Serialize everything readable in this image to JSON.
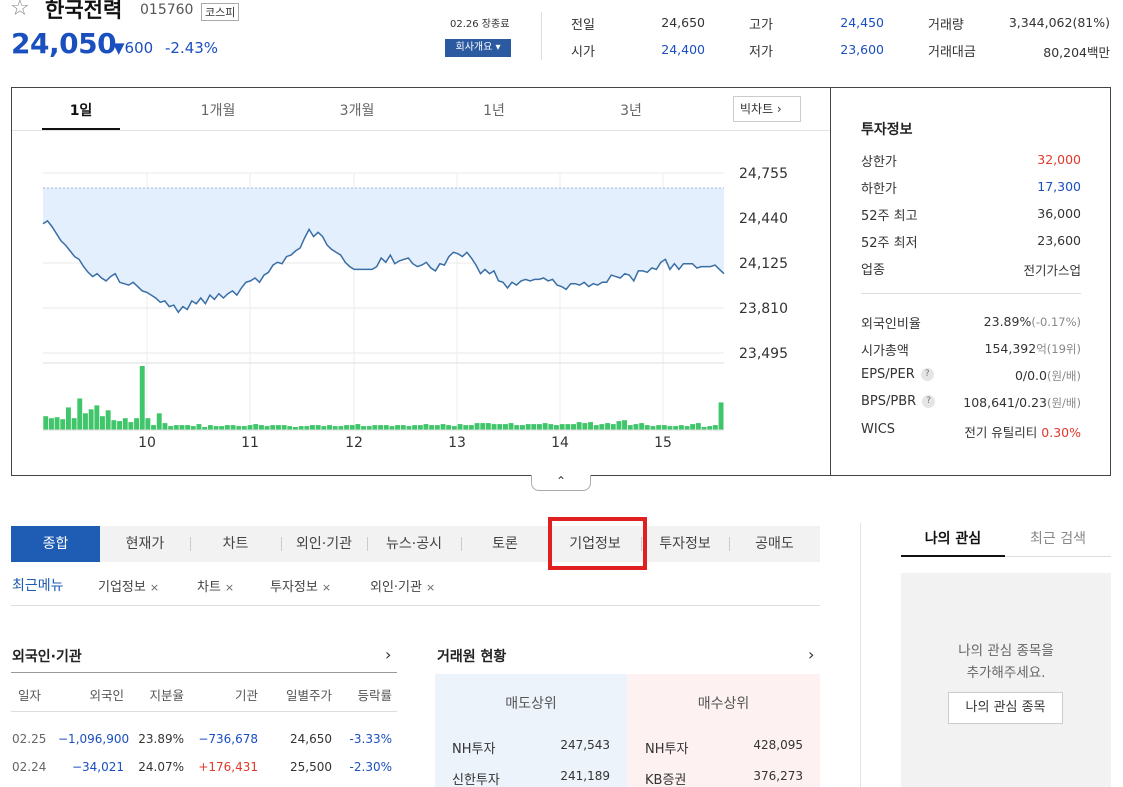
{
  "stock": {
    "name": "한국전력",
    "code": "015760",
    "market": "코스피",
    "price": "24,050",
    "change_arrow": "▼",
    "change": "600",
    "change_pct": "-2.43%",
    "status": "02.26 장종료",
    "company_btn": "회사개요 ▾"
  },
  "summary": [
    {
      "label": "전일",
      "value": "24,650",
      "color": "#333"
    },
    {
      "label": "시가",
      "value": "24,400",
      "color": "#1a4fbf"
    },
    {
      "label": "고가",
      "value": "24,450",
      "color": "#1a4fbf"
    },
    {
      "label": "저가",
      "value": "23,600",
      "color": "#1a4fbf"
    },
    {
      "label": "거래량",
      "value": "3,344,062(81%)",
      "color": "#333"
    },
    {
      "label": "거래대금",
      "value": "80,204백만",
      "color": "#333"
    }
  ],
  "chart_tabs": [
    "1일",
    "1개월",
    "3개월",
    "1년",
    "3년"
  ],
  "big_chart_btn": "빅차트 ›",
  "chart_data": {
    "type": "line",
    "x_ticks": [
      "10",
      "11",
      "12",
      "13",
      "14",
      "15"
    ],
    "y_ticks": [
      "24,755",
      "24,440",
      "24,125",
      "23,810",
      "23,495"
    ],
    "ylim": [
      23495,
      24755
    ],
    "reference_line": 24650,
    "series": [
      {
        "values": [
          24400,
          24420,
          24380,
          24330,
          24280,
          24250,
          24210,
          24170,
          24150,
          24100,
          24060,
          24030,
          24050,
          24020,
          24000,
          24030,
          24050,
          23990,
          23980,
          23970,
          23990,
          23960,
          23930,
          23920,
          23900,
          23880,
          23850,
          23860,
          23820,
          23830,
          23780,
          23820,
          23800,
          23860,
          23840,
          23880,
          23840,
          23900,
          23870,
          23910,
          23880,
          23910,
          23930,
          23900,
          23950,
          23990,
          24000,
          24020,
          23990,
          24040,
          24060,
          24110,
          24130,
          24120,
          24170,
          24180,
          24210,
          24230,
          24300,
          24360,
          24310,
          24340,
          24310,
          24250,
          24220,
          24200,
          24180,
          24130,
          24100,
          24080,
          24080,
          24080,
          24080,
          24080,
          24100,
          24160,
          24130,
          24180,
          24120,
          24140,
          24150,
          24160,
          24120,
          24100,
          24110,
          24130,
          24090,
          24070,
          24120,
          24110,
          24170,
          24200,
          24190,
          24170,
          24200,
          24160,
          24110,
          24050,
          24080,
          24050,
          24070,
          24000,
          23990,
          23950,
          23990,
          23970,
          24000,
          24010,
          24000,
          24010,
          24010,
          24020,
          24000,
          24010,
          23970,
          23960,
          23940,
          23980,
          23980,
          23970,
          23990,
          23960,
          23980,
          23970,
          23990,
          23990,
          24040,
          24030,
          24020,
          24050,
          24040,
          24000,
          24070,
          24070,
          24060,
          24090,
          24080,
          24130,
          24150,
          24080,
          24120,
          24080,
          24120,
          24120,
          24120,
          24090,
          24100,
          24100,
          24100,
          24110,
          24080,
          24050
        ]
      }
    ],
    "volume": [
      14,
      12,
      13,
      11,
      23,
      12,
      32,
      17,
      21,
      25,
      14,
      20,
      10,
      9,
      12,
      8,
      12,
      65,
      12,
      5,
      17,
      7,
      4,
      5,
      5,
      5,
      4,
      6,
      3,
      5,
      4,
      4,
      5,
      5,
      4,
      4,
      5,
      6,
      5,
      4,
      5,
      5,
      5,
      4,
      3,
      4,
      4,
      5,
      5,
      4,
      5,
      4,
      4,
      5,
      5,
      6,
      4,
      4,
      5,
      5,
      5,
      4,
      5,
      5,
      4,
      5,
      5,
      6,
      5,
      5,
      6,
      5,
      4,
      6,
      5,
      5,
      7,
      7,
      7,
      6,
      6,
      6,
      7,
      5,
      5,
      6,
      6,
      6,
      7,
      6,
      5,
      6,
      6,
      6,
      8,
      7,
      8,
      5,
      6,
      7,
      6,
      9,
      10,
      5,
      6,
      7,
      5,
      4,
      5,
      5,
      4,
      4,
      5,
      4,
      6,
      7,
      3,
      4,
      5,
      28
    ]
  },
  "invest_info": {
    "title": "투자정보",
    "rows": [
      {
        "label": "상한가",
        "value": "32,000",
        "color": "#e0382b"
      },
      {
        "label": "하한가",
        "value": "17,300",
        "color": "#1a4fbf"
      },
      {
        "label": "52주 최고",
        "value": "36,000",
        "color": "#333"
      },
      {
        "label": "52주 최저",
        "value": "23,600",
        "color": "#333"
      },
      {
        "label": "업종",
        "value": "전기가스업",
        "color": "#333"
      }
    ],
    "rows2": [
      {
        "label": "외국인비율",
        "value": "23.89%",
        "sub": "(-0.17%)",
        "help": false
      },
      {
        "label": "시가총액",
        "value": "154,392",
        "sub": "억(19위)",
        "help": false
      },
      {
        "label": "EPS/PER",
        "value": "0/0.0",
        "sub": "(원/배)",
        "help": true
      },
      {
        "label": "BPS/PBR",
        "value": "108,641/0.23",
        "sub": "(원/배)",
        "help": true
      }
    ],
    "wics": {
      "label": "WICS",
      "value": "전기 유틸리티",
      "pct": "0.30%"
    }
  },
  "menu": {
    "items": [
      "종합",
      "현재가",
      "차트",
      "외인·기관",
      "뉴스·공시",
      "토론",
      "기업정보",
      "투자정보",
      "공매도"
    ],
    "recent_label": "최근메뉴",
    "recent": [
      "기업정보",
      "차트",
      "투자정보",
      "외인·기관"
    ],
    "recent_close": "×"
  },
  "foreign": {
    "title": "외국인·기관",
    "columns": [
      "일자",
      "외국인",
      "지분율",
      "기관",
      "일별주가",
      "등락률"
    ],
    "rows": [
      {
        "date": "02.25",
        "foreign": "−1,096,900",
        "ratio": "23.89%",
        "inst": "−736,678",
        "price": "24,650",
        "pct": "-3.33%",
        "inst_color": "#1a4fbf"
      },
      {
        "date": "02.24",
        "foreign": "−34,021",
        "ratio": "24.07%",
        "inst": "+176,431",
        "price": "25,500",
        "pct": "-2.30%",
        "inst_color": "#e0382b"
      }
    ]
  },
  "trader": {
    "title": "거래원 현황",
    "sell_title": "매도상위",
    "buy_title": "매수상위",
    "sell": [
      {
        "name": "NH투자",
        "value": "247,543"
      },
      {
        "name": "신한투자",
        "value": "241,189"
      }
    ],
    "buy": [
      {
        "name": "NH투자",
        "value": "428,095"
      },
      {
        "name": "KB증권",
        "value": "376,273"
      }
    ]
  },
  "watch": {
    "tab_mine": "나의 관심",
    "tab_recent": "최근 검색",
    "msg1": "나의 관심 종목을",
    "msg2": "추가해주세요.",
    "btn": "나의 관심 종목"
  }
}
